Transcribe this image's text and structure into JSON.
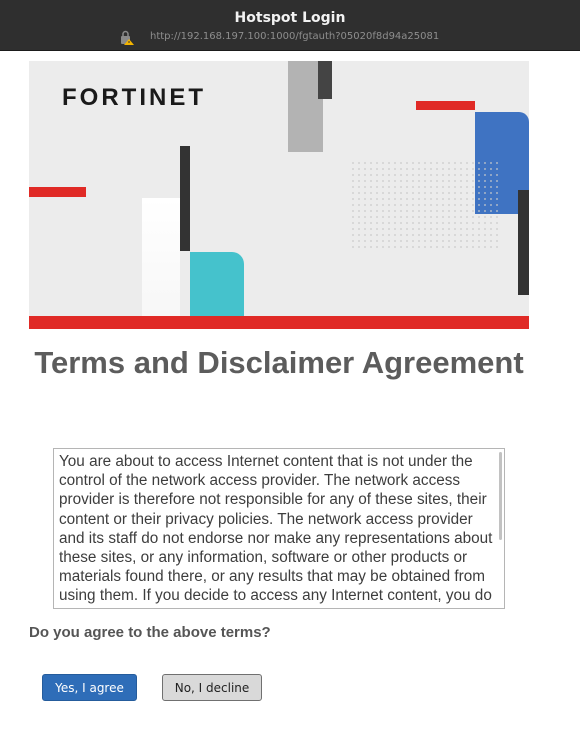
{
  "window": {
    "title": "Hotspot Login",
    "url": "http://192.168.197.100:1000/fgtauth?05020f8d94a25081",
    "lock_icon": "insecure-lock-warning-icon"
  },
  "banner": {
    "logo_text": "FORTINET",
    "colors": {
      "red": "#e02a26",
      "blue": "#3f73c2",
      "cyan": "#45c2cc",
      "dark": "#333333",
      "gray": "#b3b3b3",
      "background": "#ececec"
    }
  },
  "page": {
    "heading": "Terms and Disclaimer Agreement",
    "terms_text": "You are about to access Internet content that is not under the control of the network access provider. The network access provider is therefore not responsible for any of these sites, their content or their privacy policies. The network access provider and its staff do not endorse nor make any representations about these sites, or any information, software or other products or materials found there, or any results that may be obtained from using them. If you decide to access any Internet content, you do this entirely at your own risk and you are responsible for ensuring that any accessed material does not infringe the laws governing, but not exhaustively covering, copyright, trademarks, pornography, or any other material which is slanderous, defamatory or might cause offence in any other way.",
    "question": "Do you agree to the above terms?",
    "agree_label": "Yes, I agree",
    "decline_label": "No, I decline"
  }
}
